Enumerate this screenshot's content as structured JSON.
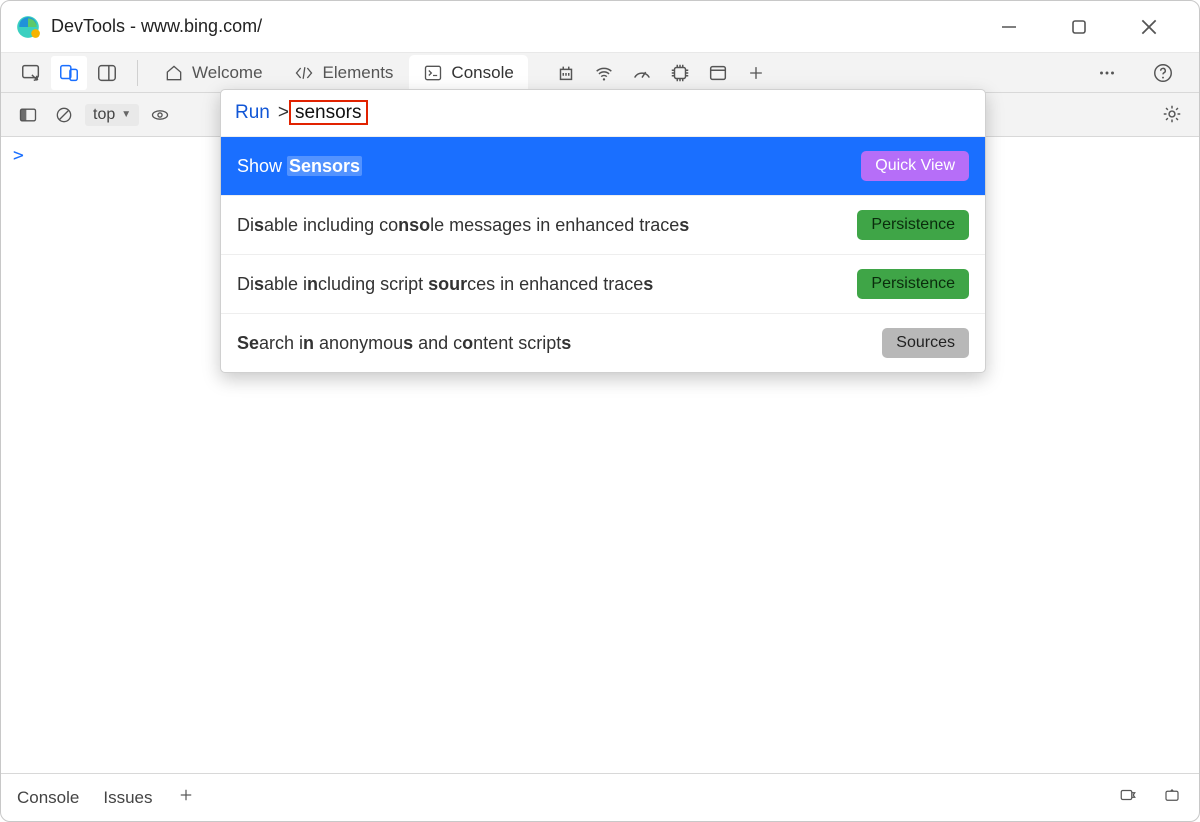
{
  "window": {
    "title": "DevTools - www.bing.com/"
  },
  "tabs": {
    "welcome": "Welcome",
    "elements": "Elements",
    "console": "Console"
  },
  "filter": {
    "context": "top"
  },
  "command_menu": {
    "prefix": "Run",
    "gt": ">",
    "query": "sensors",
    "items": [
      {
        "html": "Show <b class=\"hl2\">Sensors</b>",
        "badge": "Quick View",
        "badge_class": "badge-purple",
        "selected": true
      },
      {
        "html": "Di<b>s</b>able including co<b>nso</b>le messages in enhanced trace<b>s</b>",
        "badge": "Persistence",
        "badge_class": "badge-green",
        "selected": false
      },
      {
        "html": "Di<b>s</b>able i<b>n</b>cluding script <b>sour</b>ces in enhanced trace<b>s</b>",
        "badge": "Persistence",
        "badge_class": "badge-green",
        "selected": false
      },
      {
        "html": "<b>Se</b>arch i<b>n</b> anonymou<b>s</b> and c<b>o</b>ntent script<b>s</b>",
        "badge": "Sources",
        "badge_class": "badge-grey",
        "selected": false
      }
    ]
  },
  "drawer": {
    "console": "Console",
    "issues": "Issues"
  }
}
